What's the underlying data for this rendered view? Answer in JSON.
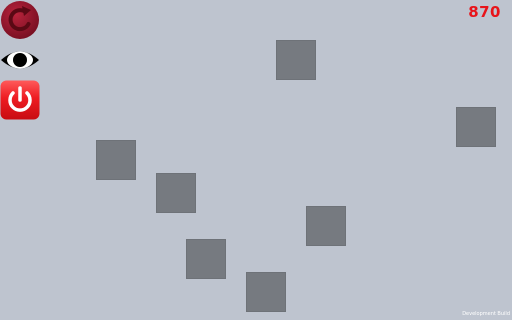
{
  "hud": {
    "score": "870",
    "build_label": "Development Build"
  },
  "buttons": {
    "restart": {
      "icon": "restart-icon",
      "color": "#8e1428"
    },
    "visibility": {
      "icon": "eye-icon",
      "color": "#000000"
    },
    "power": {
      "icon": "power-icon",
      "color": "#e8141a"
    }
  },
  "colors": {
    "background": "#bec4cf",
    "tile": "#767a80",
    "score": "#e8141a"
  }
}
